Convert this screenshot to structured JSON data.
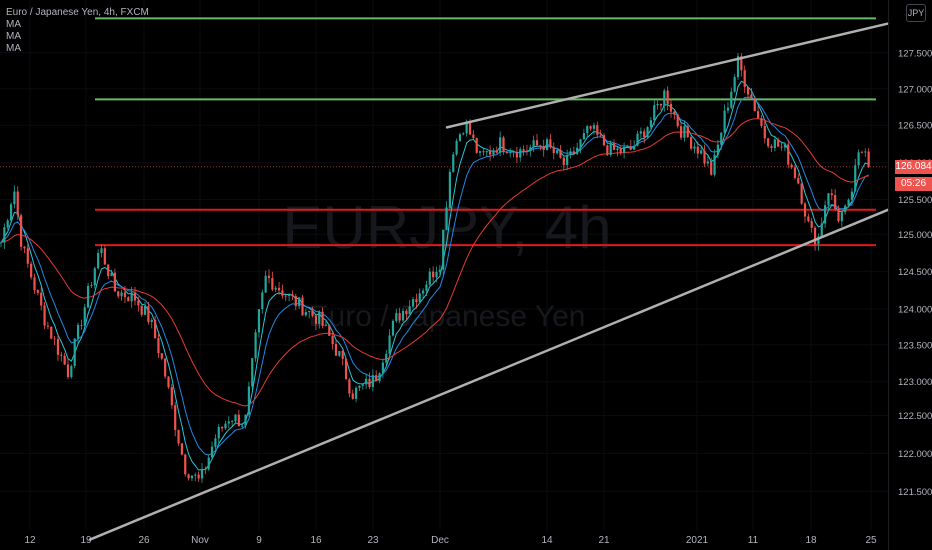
{
  "legend": {
    "title": "Euro / Japanese Yen, 4h, FXCM",
    "indicators": [
      "MA",
      "MA",
      "MA"
    ]
  },
  "currency_button": "JPY",
  "last_price_label": "126.084",
  "countdown_label": "05:26",
  "watermark": {
    "symbol": "EURJPY, 4h",
    "name": "Euro / Japanese Yen"
  },
  "colors": {
    "background": "#000000",
    "up": "#26a69a",
    "down": "#ef5350",
    "ma_fast": "#26c6da",
    "ma_mid": "#1e88e5",
    "ma_slow": "#e53935",
    "resistance": "#66bb6a",
    "support": "#e01a1a",
    "trend": "#b0b0b0",
    "price_tag": "#ef5350"
  },
  "chart_data": {
    "type": "candlestick",
    "title": "Euro / Japanese Yen, 4h, FXCM",
    "ylim": [
      121.15,
      128.35
    ],
    "yticks": [
      "121.500",
      "122.000",
      "122.500",
      "123.000",
      "123.500",
      "124.000",
      "124.500",
      "125.000",
      "125.500",
      "126.000",
      "126.500",
      "127.000",
      "127.500"
    ],
    "xticks": [
      "12",
      "19",
      "26",
      "Nov",
      "9",
      "16",
      "23",
      "Dec",
      "14",
      "21",
      "2021",
      "11",
      "18",
      "25"
    ],
    "x_key": [
      [
        0,
        125.0
      ],
      [
        14,
        125.8
      ],
      [
        22,
        125.0
      ],
      [
        45,
        124.0
      ],
      [
        68,
        123.3
      ],
      [
        85,
        124.2
      ],
      [
        100,
        125.0
      ],
      [
        115,
        124.4
      ],
      [
        135,
        124.3
      ],
      [
        150,
        124.0
      ],
      [
        163,
        123.4
      ],
      [
        175,
        122.6
      ],
      [
        185,
        122.0
      ],
      [
        200,
        121.8
      ],
      [
        215,
        122.4
      ],
      [
        230,
        122.7
      ],
      [
        245,
        122.6
      ],
      [
        258,
        124.0
      ],
      [
        266,
        124.6
      ],
      [
        290,
        124.3
      ],
      [
        320,
        124.0
      ],
      [
        340,
        123.5
      ],
      [
        352,
        123.0
      ],
      [
        375,
        123.2
      ],
      [
        395,
        124.0
      ],
      [
        420,
        124.4
      ],
      [
        440,
        124.8
      ],
      [
        452,
        126.3
      ],
      [
        465,
        126.7
      ],
      [
        480,
        126.2
      ],
      [
        500,
        126.4
      ],
      [
        520,
        126.3
      ],
      [
        545,
        126.4
      ],
      [
        565,
        126.1
      ],
      [
        590,
        126.6
      ],
      [
        610,
        126.3
      ],
      [
        630,
        126.3
      ],
      [
        650,
        126.7
      ],
      [
        665,
        127.1
      ],
      [
        680,
        126.6
      ],
      [
        700,
        126.3
      ],
      [
        712,
        126.0
      ],
      [
        725,
        126.8
      ],
      [
        738,
        127.5
      ],
      [
        752,
        127.0
      ],
      [
        765,
        126.5
      ],
      [
        785,
        126.3
      ],
      [
        798,
        125.9
      ],
      [
        810,
        125.2
      ],
      [
        818,
        125.1
      ],
      [
        828,
        125.8
      ],
      [
        838,
        125.4
      ],
      [
        848,
        125.5
      ],
      [
        858,
        126.2
      ],
      [
        866,
        126.4
      ],
      [
        872,
        126.08
      ]
    ],
    "moving_averages": [
      {
        "lag": 5
      },
      {
        "lag": 10
      },
      {
        "lag": 34
      }
    ],
    "horizontal_levels": [
      {
        "kind": "resistance",
        "price": 128.1
      },
      {
        "kind": "resistance",
        "price": 127.0
      },
      {
        "kind": "support",
        "price": 125.5
      },
      {
        "kind": "support",
        "price": 125.02
      }
    ],
    "trend_lines": [
      {
        "from": [
          90,
          121.02
        ],
        "to": [
          888,
          125.5
        ]
      },
      {
        "from": [
          447,
          126.62
        ],
        "to": [
          888,
          128.03
        ]
      }
    ],
    "last_price": 126.084
  }
}
